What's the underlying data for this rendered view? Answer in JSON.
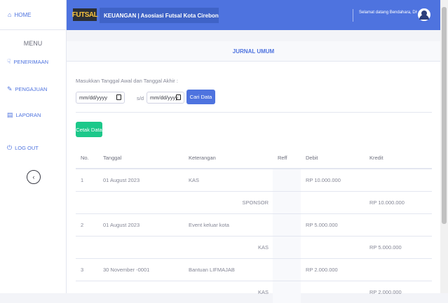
{
  "sidebar": {
    "home_label": "HOME",
    "menu_heading": "MENU",
    "items": [
      {
        "label": "PENERIMAAN",
        "icon": "hand-holding-icon"
      },
      {
        "label": "PENGAJUAN",
        "icon": "edit-icon"
      },
      {
        "label": "LAPORAN",
        "icon": "chart-bar-icon"
      },
      {
        "label": "LOG OUT",
        "icon": "power-icon"
      }
    ],
    "toggle_glyph": "‹"
  },
  "topbar": {
    "logo_text": "FUTSAL",
    "title": "KEUANGAN | Asosiasi Futsal Kota Cirebon",
    "welcome": "Selamat datang Bendahara, Diva",
    "accent": "#4e73df"
  },
  "card": {
    "header": "JURNAL UMUM",
    "form_label": "Masukkan Tanggal Awal dan Tanggal Akhir :",
    "start_date_placeholder": "mm/dd/yyyy",
    "end_date_placeholder": "mm/dd/yyyy",
    "separator": "s/d",
    "search_button": "Cari Data",
    "print_button": "Cetak Data"
  },
  "table": {
    "columns": [
      "No.",
      "Tanggal",
      "Keterangan",
      "Reff",
      "Debit",
      "Kredit"
    ],
    "rows": [
      {
        "no": "1",
        "tanggal": "01 August 2023",
        "keterangan": "KAS",
        "reff": "",
        "debit": "RP 10.000.000",
        "kredit": ""
      },
      {
        "no": "",
        "tanggal": "",
        "keterangan": "SPONSOR",
        "reff": "",
        "debit": "",
        "kredit": "RP 10.000.000"
      },
      {
        "no": "2",
        "tanggal": "01 August 2023",
        "keterangan": "Event keluar kota",
        "reff": "",
        "debit": "RP 5.000.000",
        "kredit": ""
      },
      {
        "no": "",
        "tanggal": "",
        "keterangan": "KAS",
        "reff": "",
        "debit": "",
        "kredit": "RP 5.000.000"
      },
      {
        "no": "3",
        "tanggal": "30 November -0001",
        "keterangan": "Bantuan LIFMAJAB",
        "reff": "",
        "debit": "RP 2.000.000",
        "kredit": ""
      },
      {
        "no": "",
        "tanggal": "",
        "keterangan": "KAS",
        "reff": "",
        "debit": "",
        "kredit": "RP 2.000.000"
      }
    ]
  }
}
